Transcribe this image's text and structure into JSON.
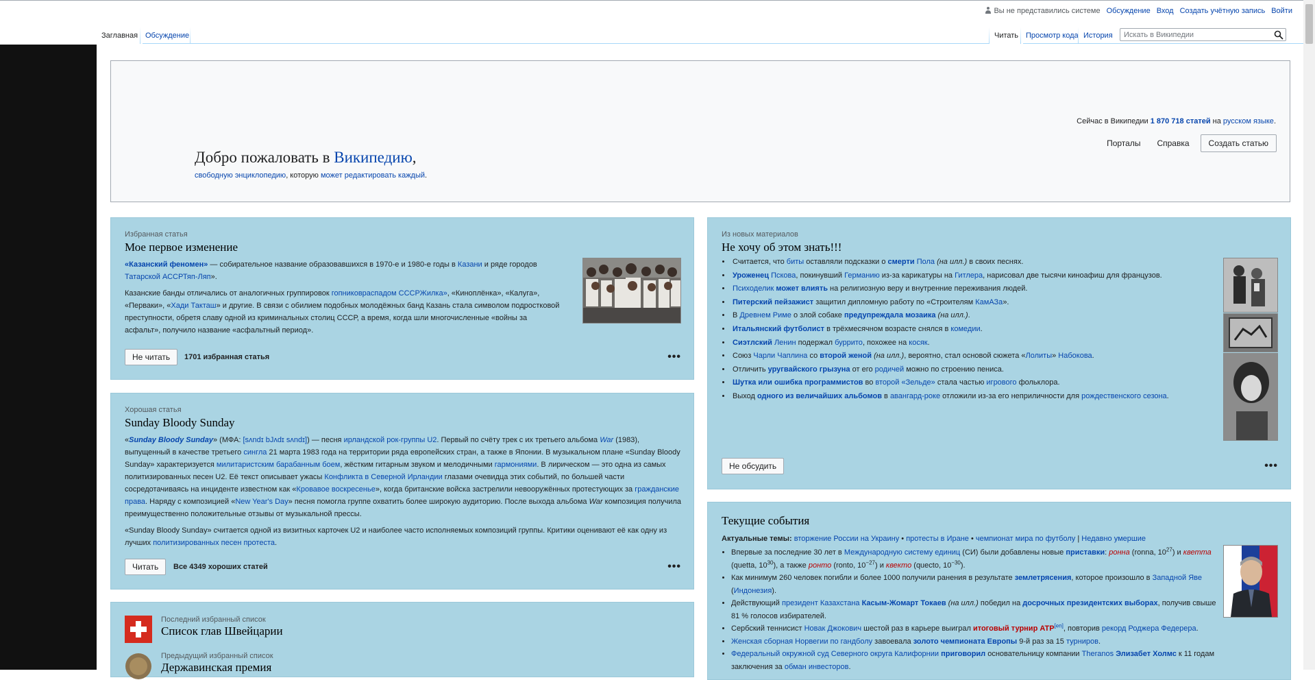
{
  "header": {
    "personal": {
      "not_logged": "Вы не представились системе",
      "talk": "Обсуждение",
      "login": "Вход",
      "create_account": "Создать учётную запись",
      "logout": "Войти"
    },
    "tabs_left": [
      {
        "label": "Заглавная"
      },
      {
        "label": "Обсуждение"
      }
    ],
    "tabs_right": [
      {
        "label": "Читать"
      },
      {
        "label": "Просмотр кода"
      },
      {
        "label": "История"
      }
    ],
    "search_placeholder": "Искать в Википедии"
  },
  "welcome": {
    "title_prefix": "Добро пожаловать в ",
    "title_link": "Википедию",
    "title_suffix": ",",
    "sub_link1": "свободную энциклопедию",
    "sub_mid": ", которую ",
    "sub_link2": "может редактировать каждый",
    "sub_end": ".",
    "stats_prefix": "Сейчас в Википедии ",
    "stats_count": "1 870 718 статей",
    "stats_mid": " на ",
    "stats_lang": "русском языке",
    "stats_end": ".",
    "portals": "Порталы",
    "help": "Справка",
    "create": "Создать статью"
  },
  "featured": {
    "label": "Избранная статья",
    "title": "Мое первое изменение",
    "p1": {
      "a": "«Казанский феномен»",
      "b": " — собирательное название образовавшихся в 1970-е и 1980-е годы в ",
      "c": "Казани",
      "d": " и ряде городов ",
      "e": "Татарской АССРТяп-Ляп",
      "f": "»."
    },
    "p2": {
      "a": "Казанские банды отличались от аналогичных группировок ",
      "b": "гопниковраспадом СССРЖилка»",
      "c": ", «Киноплёнка», «Калуга», «Перваки», «",
      "d": "Хади Такташ",
      "e": "» и другие. В связи с обилием подобных молодёжных банд Казань стала символом подростковой преступности, обретя славу одной из криминальных столиц СССР, а время, когда шли многочисленные «войны за асфальт», получило название «асфальтный период»."
    },
    "button": "Не читать",
    "count": "1701 избранная статья",
    "more": "•••"
  },
  "good": {
    "label": "Хорошая статья",
    "title": "Sunday Bloody Sunday",
    "p1": {
      "a": "«",
      "b": "Sunday Bloody Sunday",
      "c": "» (МФА: ",
      "d": "[sʌndɪ bJʌdɪ sʌndɪ]",
      "e": ") — песня ",
      "f": "ирландской рок-группы U2",
      "g": ". Первый по счёту трек с их третьего альбома ",
      "h": "War",
      "i": " (1983), выпущенный в качестве третьего ",
      "j": "сингла",
      "k": " 21 марта 1983 года на территории ряда европейских стран, а также в Японии. В музыкальном плане «Sunday Bloody Sunday» характеризуется ",
      "l": "милитаристским барабанным боем",
      "m": ", жёстким гитарным звуком и мелодичными ",
      "n": "гармониями",
      "o": ". В лирическом — это одна из самых политизированных песен U2. Её текст описывает ужасы ",
      "p": "Конфликта в Северной Ирландии",
      "q": " глазами очевидца этих событий, по большей части сосредотачиваясь на инциденте известном как «",
      "r": "Кровавое воскресенье",
      "s": "», когда британские войска застрелили невооружённых протестующих за ",
      "t": "гражданские права",
      "u": ". Наряду с композицией «",
      "v": "New Year's Day",
      "w": "» песня помогла группе охватить более широкую аудиторию. После выхода альбома ",
      "x": "War",
      "y": " композиция получила преимущественно положительные отзывы от музыкальной прессы."
    },
    "p2": {
      "a": "«Sunday Bloody Sunday» считается одной из визитных карточек U2 и наиболее часто исполняемых композиций группы. Критики оценивают её как одну из лучших ",
      "b": "политизированных песен протеста",
      "c": "."
    },
    "button": "Читать",
    "count": "Все 4349 хороших статей",
    "more": "•••"
  },
  "lists": {
    "last_label": "Последний избранный список",
    "last_title": "Список глав Швейцарии",
    "prev_label": "Предыдущий избранный список",
    "prev_title": "Державинская премия"
  },
  "dyk": {
    "label": "Из новых материалов",
    "title": "Не хочу об этом знать!!!",
    "button": "Не обсудить",
    "more": "•••"
  },
  "current": {
    "title": "Текущие события",
    "topics_label": "Актуальные темы:",
    "topics": [
      "вторжение России на Украину",
      "протесты в Иране",
      "чемпионат мира по футболу"
    ],
    "topics_sep": " • ",
    "recent": "Недавно умершие"
  },
  "colors": {
    "link": "#0645ad",
    "panel": "#aad4e3",
    "red": "#ba0000"
  }
}
